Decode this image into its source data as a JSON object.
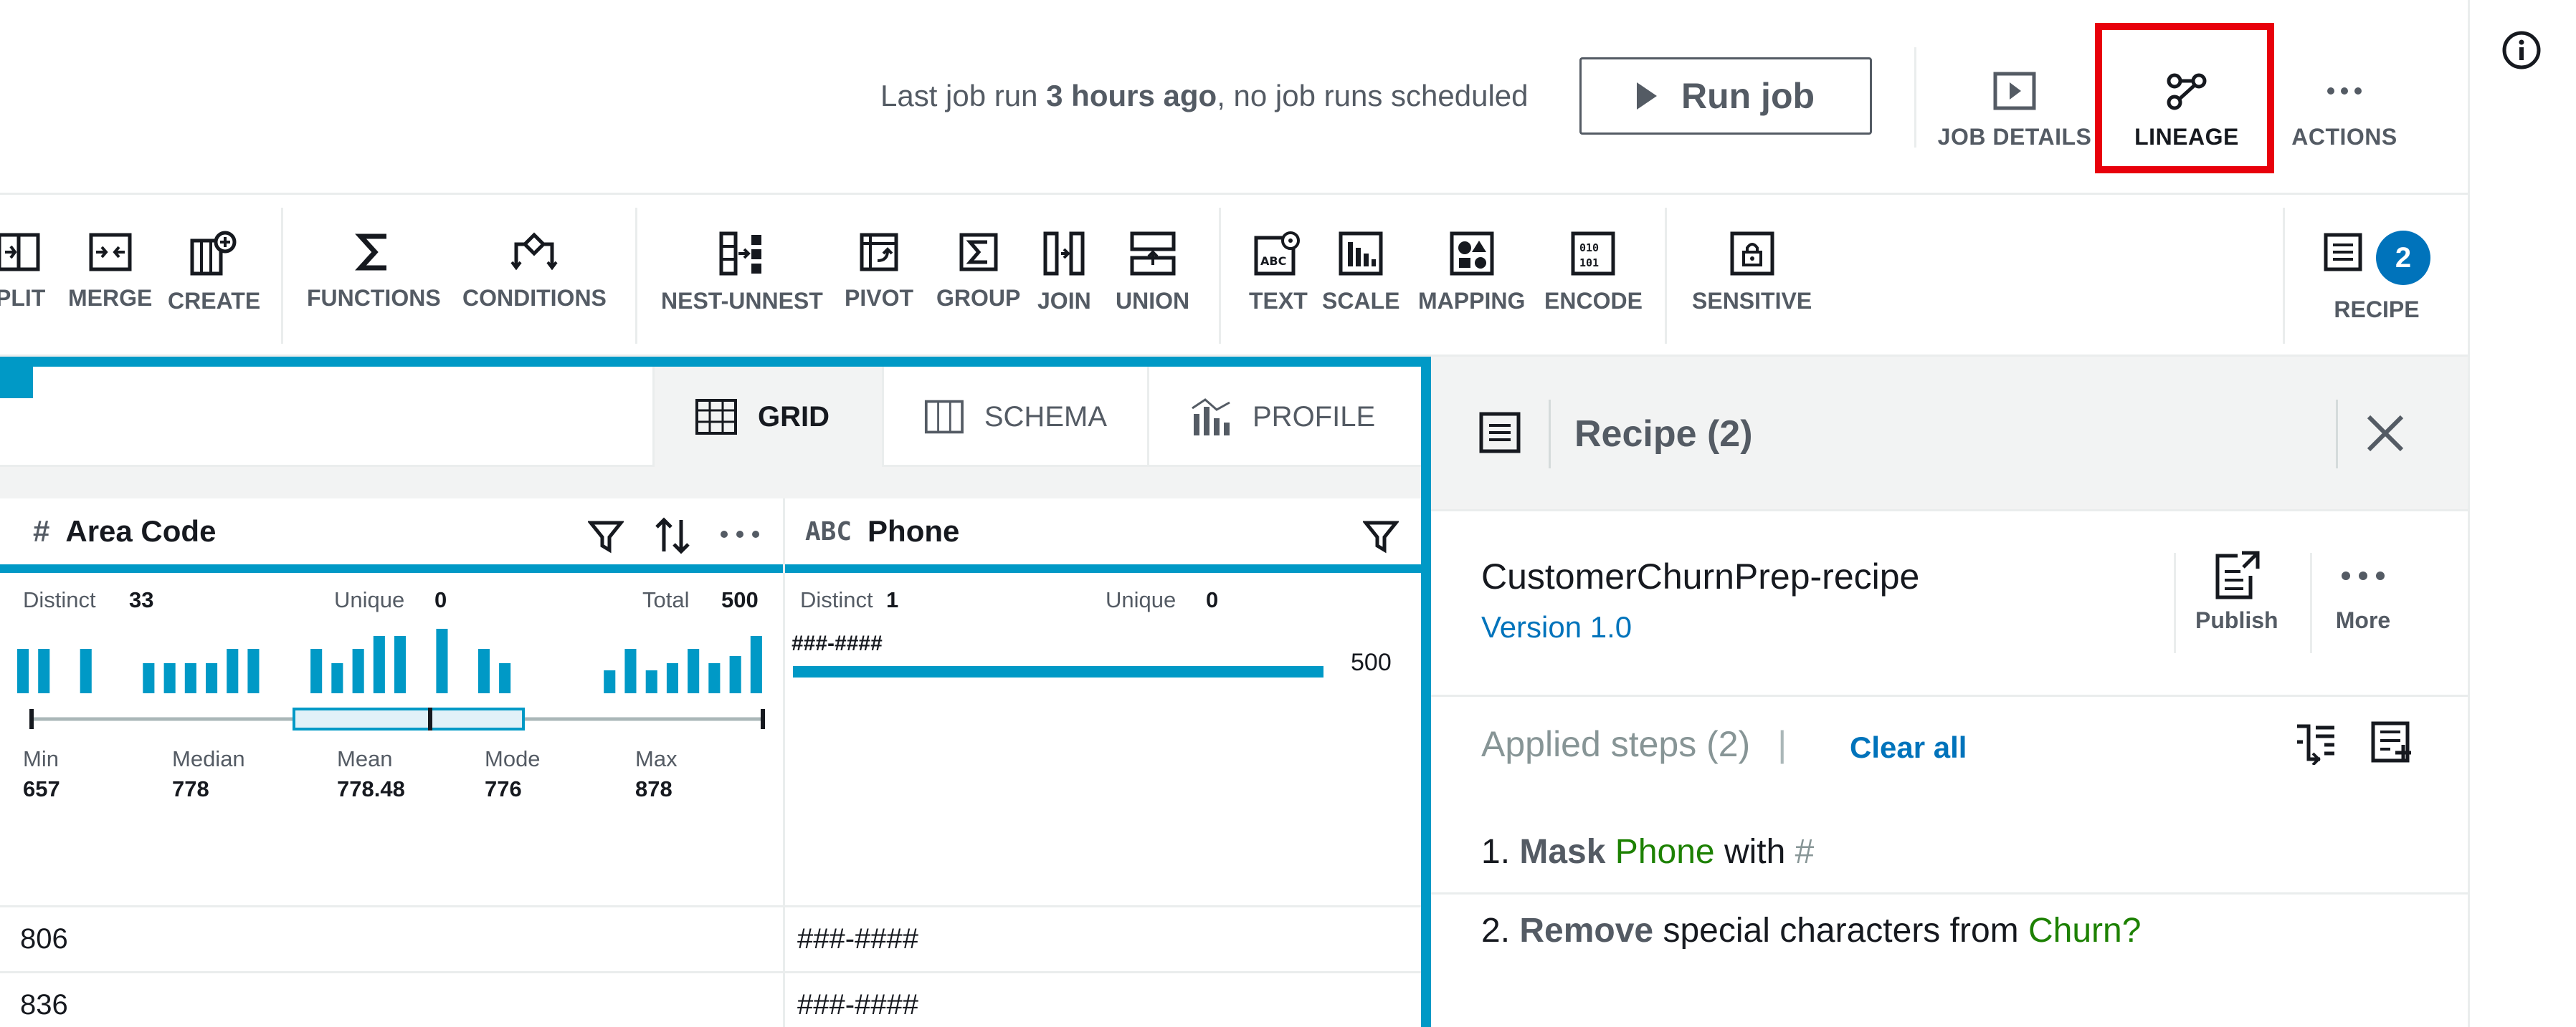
{
  "header": {
    "last_run_prefix": "Last job run ",
    "last_run_time": "3 hours ago",
    "last_run_suffix": ", no job runs scheduled",
    "run_job_label": "Run job",
    "job_details_label": "JOB DETAILS",
    "lineage_label": "LINEAGE",
    "actions_label": "ACTIONS",
    "highlight_color": "#e8000b"
  },
  "toolbar": {
    "split_label": "PLIT",
    "merge_label": "MERGE",
    "create_label": "CREATE",
    "functions_label": "FUNCTIONS",
    "conditions_label": "CONDITIONS",
    "nest_unnest_label": "NEST-UNNEST",
    "pivot_label": "PIVOT",
    "group_label": "GROUP",
    "join_label": "JOIN",
    "union_label": "UNION",
    "text_label": "TEXT",
    "scale_label": "SCALE",
    "mapping_label": "MAPPING",
    "encode_label": "ENCODE",
    "sensitive_label": "SENSITIVE",
    "recipe_label": "RECIPE",
    "recipe_count": "2"
  },
  "view_tabs": {
    "grid": "GRID",
    "schema": "SCHEMA",
    "profile": "PROFILE"
  },
  "columns": {
    "area_code": {
      "type_glyph": "#",
      "name": "Area Code",
      "distinct_label": "Distinct",
      "distinct_value": "33",
      "unique_label": "Unique",
      "unique_value": "0",
      "total_label": "Total",
      "total_value": "500",
      "histogram": [
        0.62,
        0.62,
        0.0,
        0.62,
        0.0,
        0.0,
        0.42,
        0.42,
        0.42,
        0.42,
        0.62,
        0.62,
        0.0,
        0.0,
        0.62,
        0.42,
        0.62,
        0.8,
        0.8,
        0.0,
        0.9,
        0.0,
        0.62,
        0.42,
        0.0,
        0.0,
        0.0,
        0.0,
        0.32,
        0.62,
        0.32,
        0.42,
        0.62,
        0.42,
        0.52,
        0.8
      ],
      "min_label": "Min",
      "min_value": "657",
      "median_label": "Median",
      "median_value": "778",
      "mean_label": "Mean",
      "mean_value": "778.48",
      "mode_label": "Mode",
      "mode_value": "776",
      "max_label": "Max",
      "max_value": "878"
    },
    "phone": {
      "type_glyph": "ABC",
      "name": "Phone",
      "distinct_label": "Distinct",
      "distinct_value": "1",
      "unique_label": "Unique",
      "unique_value": "0",
      "pattern": "###-####",
      "pattern_count": "500",
      "pattern_fraction": 1.0
    }
  },
  "rows": [
    {
      "area_code": "806",
      "phone": "###-####"
    },
    {
      "area_code": "836",
      "phone": "###-####"
    }
  ],
  "recipe_panel": {
    "title": "Recipe (2)",
    "name": "CustomerChurnPrep-recipe",
    "version": "Version 1.0",
    "publish_label": "Publish",
    "more_label": "More",
    "applied_steps": "Applied steps (2)",
    "separator": "|",
    "clear_all": "Clear all",
    "steps": [
      {
        "num": "1.",
        "action": "Mask",
        "field": "Phone",
        "mid": "with",
        "arg": "#"
      },
      {
        "num": "2.",
        "action": "Remove",
        "mid": "special characters from",
        "field": "Churn?"
      }
    ]
  },
  "colors": {
    "accent": "#0099c6",
    "link": "#0073bb",
    "green": "#1d8102"
  }
}
